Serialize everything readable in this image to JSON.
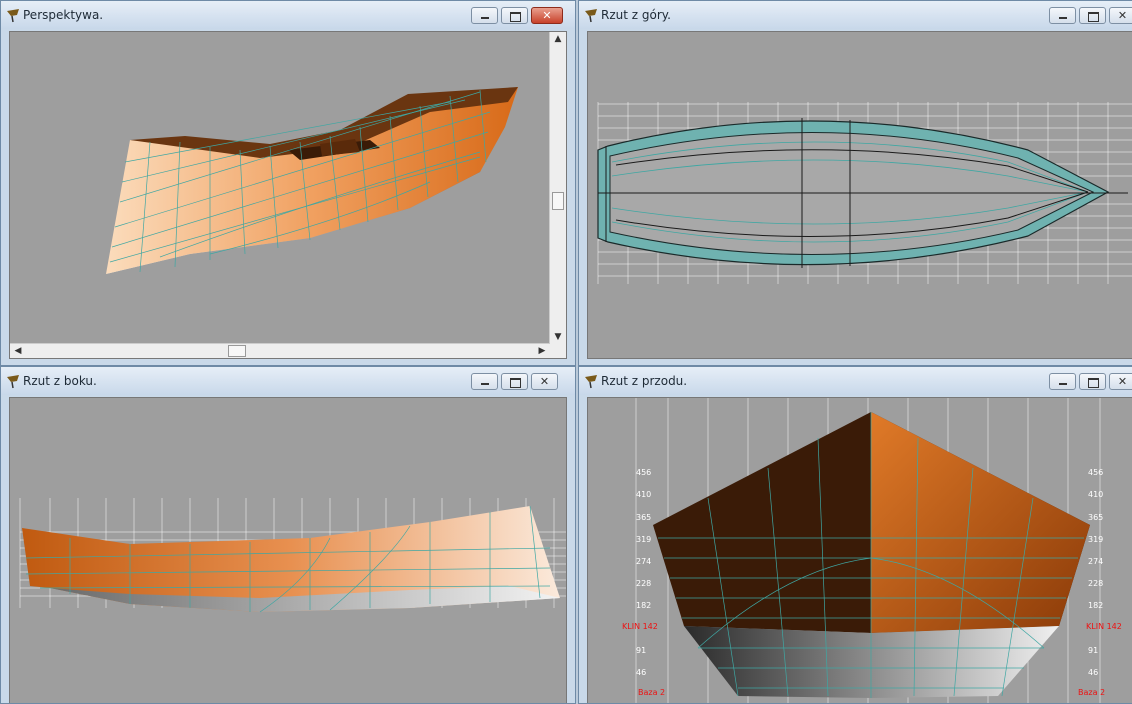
{
  "windows": {
    "perspective": {
      "title": "Perspektywa."
    },
    "top": {
      "title": "Rzut z góry."
    },
    "side": {
      "title": "Rzut z boku."
    },
    "front": {
      "title": "Rzut z przodu."
    }
  },
  "front_view": {
    "left_scale": [
      "456",
      "410",
      "365",
      "319",
      "274",
      "228",
      "182",
      "91",
      "46"
    ],
    "right_scale": [
      "456",
      "410",
      "365",
      "319",
      "274",
      "228",
      "182",
      "91",
      "46"
    ],
    "left_label_klin": "KLIN 142",
    "right_label_klin": "KLIN 142",
    "left_label_baza": "Baza 2",
    "right_label_baza": "Baza 2"
  },
  "colors": {
    "hull_light": "#f8d3ae",
    "hull_orange": "#e07a28",
    "hull_dark": "#3a1b07",
    "grid": "#3fa7a3",
    "background": "#9e9e9e"
  }
}
